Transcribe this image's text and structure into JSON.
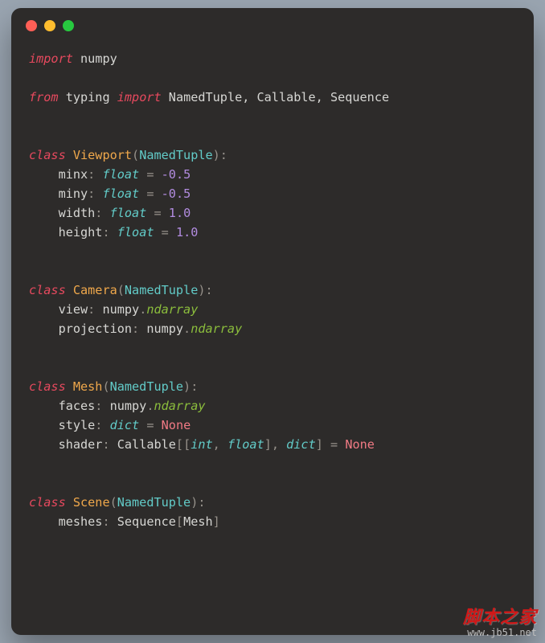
{
  "code": {
    "l1": {
      "kw1": "import",
      "mod1": "numpy"
    },
    "l2": {
      "kw1": "from",
      "mod1": "typing",
      "kw2": "import",
      "names": "NamedTuple, Callable, Sequence"
    },
    "viewport": {
      "kw": "class",
      "name": "Viewport",
      "base": "NamedTuple",
      "a1": {
        "n": "minx",
        "t": "float",
        "v": "-0.5"
      },
      "a2": {
        "n": "miny",
        "t": "float",
        "v": "-0.5"
      },
      "a3": {
        "n": "width",
        "t": "float",
        "v": "1.0"
      },
      "a4": {
        "n": "height",
        "t": "float",
        "v": "1.0"
      }
    },
    "camera": {
      "kw": "class",
      "name": "Camera",
      "base": "NamedTuple",
      "a1": {
        "n": "view",
        "mod": "numpy",
        "t": "ndarray"
      },
      "a2": {
        "n": "projection",
        "mod": "numpy",
        "t": "ndarray"
      }
    },
    "mesh": {
      "kw": "class",
      "name": "Mesh",
      "base": "NamedTuple",
      "a1": {
        "n": "faces",
        "mod": "numpy",
        "t": "ndarray"
      },
      "a2": {
        "n": "style",
        "t": "dict",
        "v": "None"
      },
      "a3": {
        "n": "shader",
        "t": "Callable",
        "p1": "int",
        "p2": "float",
        "ret": "dict",
        "v": "None"
      }
    },
    "scene": {
      "kw": "class",
      "name": "Scene",
      "base": "NamedTuple",
      "a1": {
        "n": "meshes",
        "t": "Sequence",
        "param": "Mesh"
      }
    }
  },
  "watermark": {
    "line1": "脚本之家",
    "line2": "www.jb51.net"
  }
}
